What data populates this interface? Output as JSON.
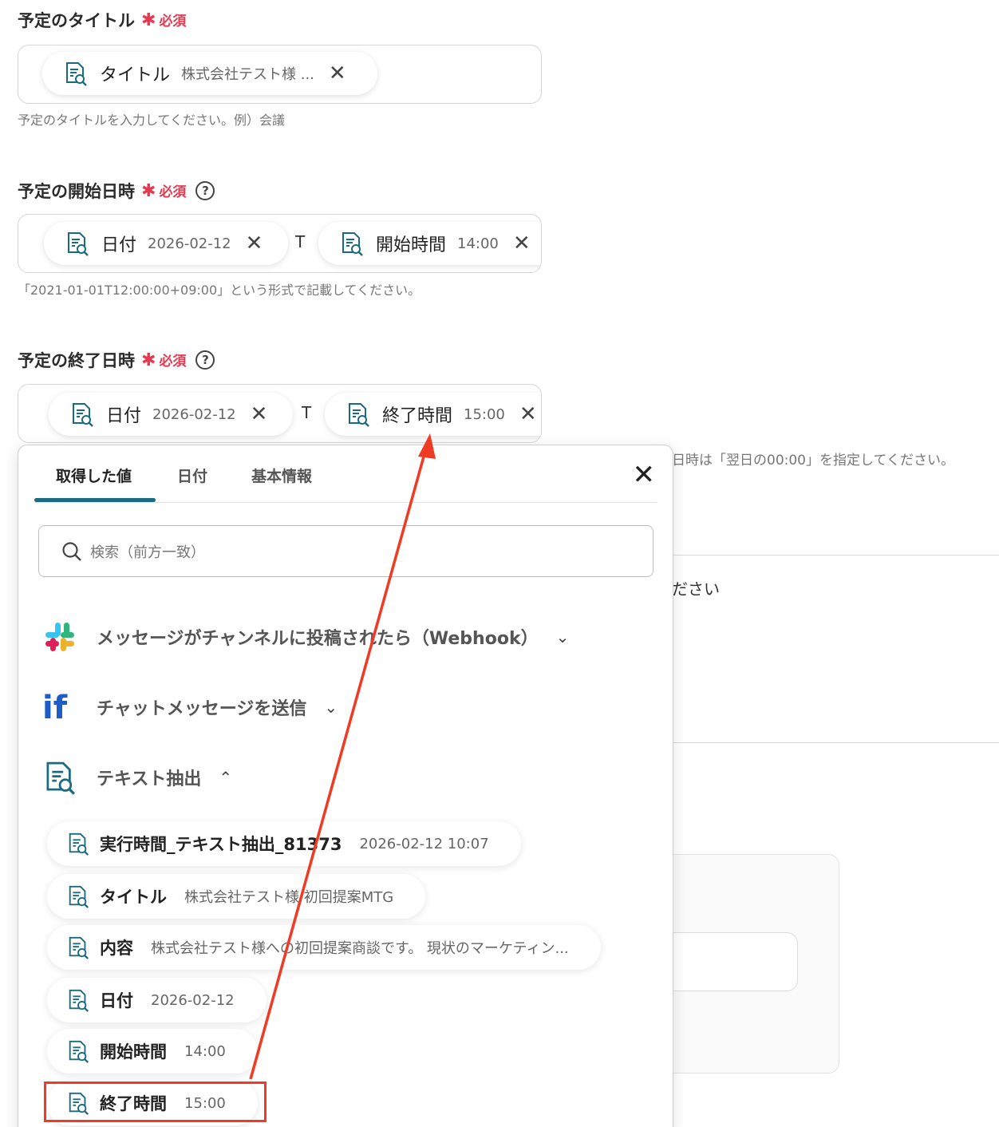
{
  "fields": {
    "title": {
      "label": "予定のタイトル",
      "required_mark": "✱",
      "required_text": "必須",
      "pill_name": "タイトル",
      "pill_value": "株式会社テスト様 ...",
      "hint": "予定のタイトルを入力してください。例）会議"
    },
    "start": {
      "label": "予定の開始日時",
      "required_mark": "✱",
      "required_text": "必須",
      "help": "?",
      "pill1_name": "日付",
      "pill1_value": "2026-02-12",
      "separator": "T",
      "pill2_name": "開始時間",
      "pill2_value": "14:00",
      "hint": "「2021-01-01T12:00:00+09:00」という形式で記載してください。"
    },
    "end": {
      "label": "予定の終了日時",
      "required_mark": "✱",
      "required_text": "必須",
      "help": "?",
      "pill1_name": "日付",
      "pill1_value": "2026-02-12",
      "separator": "T",
      "pill2_name": "終了時間",
      "pill2_value": "15:00",
      "hint_visible": "日時は「翌日の00:00」を指定してください。"
    }
  },
  "background": {
    "partial_text": "ださい"
  },
  "popup": {
    "tabs": [
      "取得した値",
      "日付",
      "基本情報"
    ],
    "close": "✕",
    "search_placeholder": "検索（前方一致）",
    "sections": [
      {
        "title": "メッセージがチャンネルに投稿されたら（Webhook）",
        "icon": "slack-icon",
        "state": "collapsed"
      },
      {
        "title": "チャットメッセージを送信",
        "icon": "if-icon",
        "state": "collapsed"
      },
      {
        "title": "テキスト抽出",
        "icon": "text-extract-icon",
        "state": "expanded"
      }
    ],
    "items": [
      {
        "name": "実行時間_テキスト抽出_81373",
        "value": "2026-02-12 10:07"
      },
      {
        "name": "タイトル",
        "value": "株式会社テスト様 初回提案MTG"
      },
      {
        "name": "内容",
        "value": "株式会社テスト様への初回提案商談です。 現状のマーケティン..."
      },
      {
        "name": "日付",
        "value": "2026-02-12"
      },
      {
        "name": "開始時間",
        "value": "14:00"
      },
      {
        "name": "終了時間",
        "value": "15:00"
      }
    ]
  },
  "colors": {
    "required": "#e8384f",
    "tab_accent": "#1a6b80",
    "annotation": "#ef3b24"
  }
}
